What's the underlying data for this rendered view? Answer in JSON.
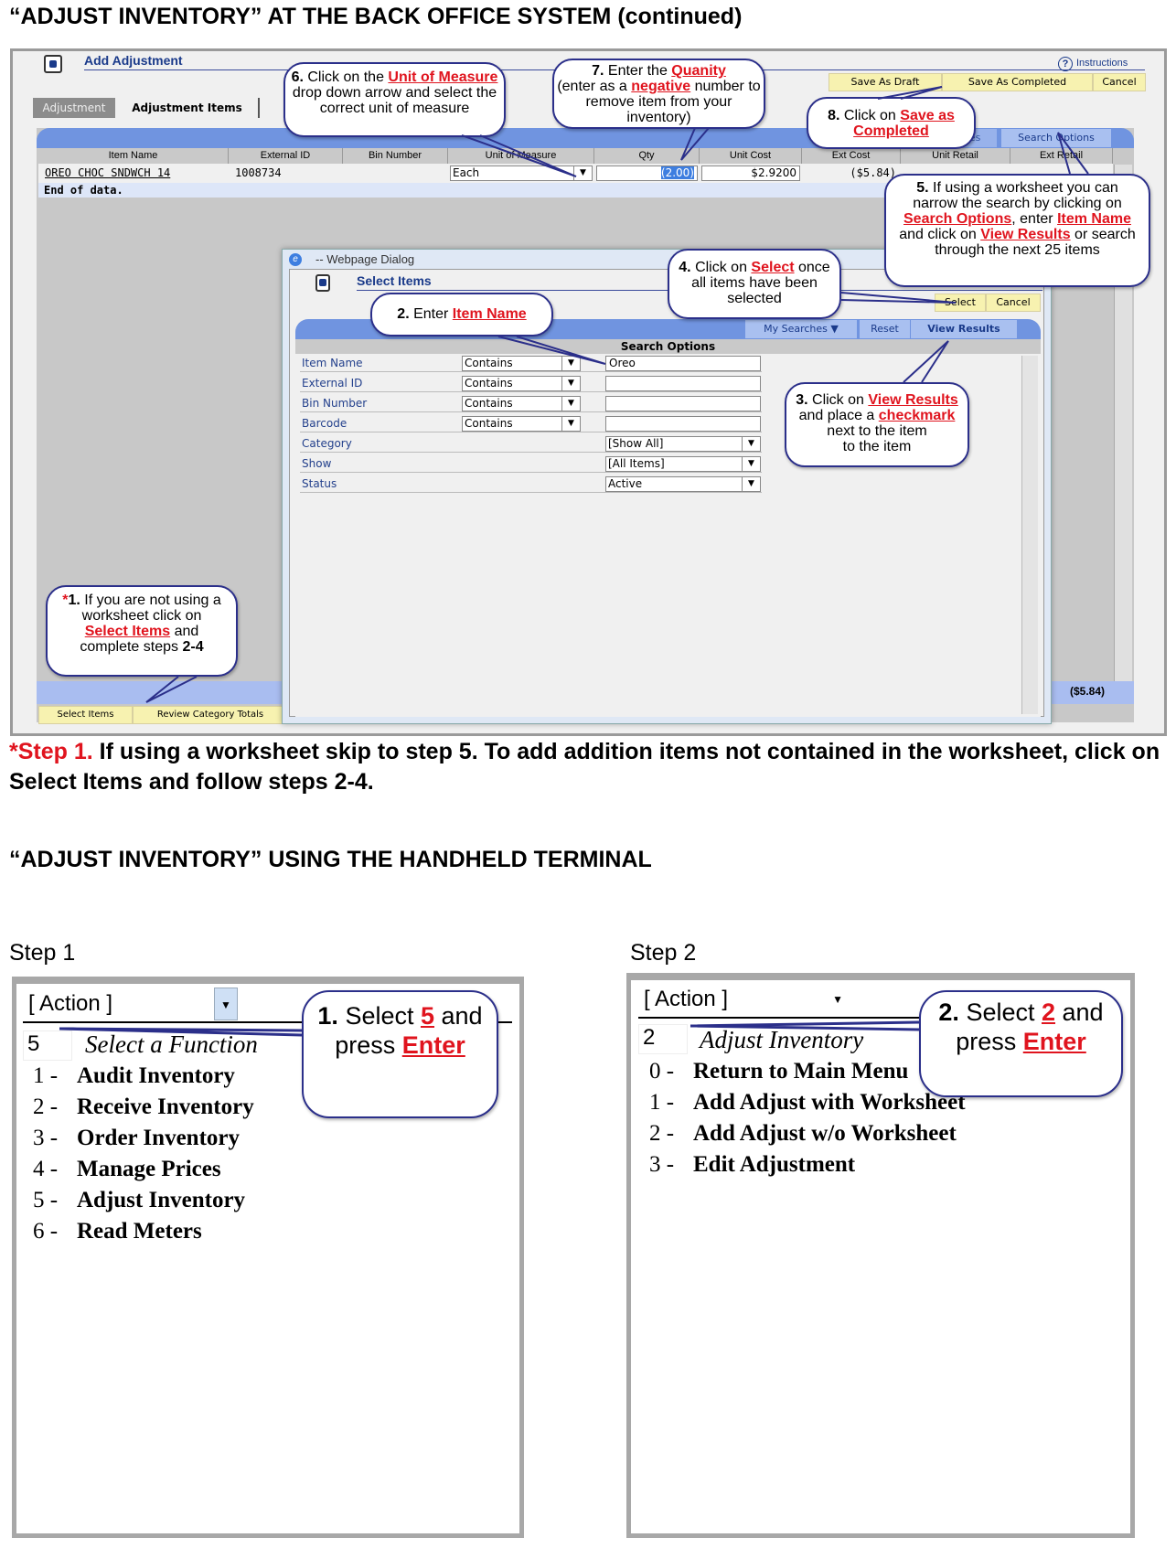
{
  "heading1": "“ADJUST INVENTORY” AT THE BACK OFFICE SYSTEM (continued)",
  "app": {
    "title": "Add Adjustment",
    "instructions": "Instructions",
    "buttons": {
      "save_draft": "Save As Draft",
      "save_completed": "Save As Completed",
      "cancel": "Cancel"
    },
    "tabs": [
      {
        "label": "Adjustment"
      },
      {
        "label": "Adjustment Items"
      }
    ],
    "search_options": "Search Options",
    "my_searches": "My Searches",
    "table": {
      "columns": [
        "Item Name",
        "External ID",
        "Bin Number",
        "Unit of Measure",
        "Qty",
        "Unit Cost",
        "Ext Cost",
        "Unit Retail",
        "Ext Retail"
      ],
      "row": {
        "item_name": "OREO CHOC SNDWCH 14",
        "external_id": "1008734",
        "bin": "",
        "uom": "Each",
        "qty": "(2.00)",
        "unit_cost": "$2.9200",
        "ext_cost": "($5.84)"
      },
      "end": "End of data.",
      "total": "($5.84)"
    },
    "bottom_buttons": {
      "select_items": "Select Items",
      "review": "Review Category Totals"
    }
  },
  "dialog": {
    "titlebar": "-- Webpage Dialog",
    "title": "Select Items",
    "select": "Select",
    "cancel": "Cancel",
    "my_searches": "My Searches",
    "reset": "Reset",
    "view_results": "View Results",
    "section": "Search Options",
    "rows": [
      {
        "label": "Item Name",
        "op": "Contains",
        "value": "Oreo"
      },
      {
        "label": "External ID",
        "op": "Contains",
        "value": ""
      },
      {
        "label": "Bin Number",
        "op": "Contains",
        "value": ""
      },
      {
        "label": "Barcode",
        "op": "Contains",
        "value": ""
      },
      {
        "label": "Category",
        "value": "[Show All]"
      },
      {
        "label": "Show",
        "value": "[All Items]"
      },
      {
        "label": "Status",
        "value": "Active"
      }
    ]
  },
  "callouts": {
    "c6": {
      "n": "6.",
      "a": " Click on the ",
      "r": "Unit of Measure",
      "b": " drop down arrow and select the correct unit of measure"
    },
    "c7": {
      "n": "7.",
      "a": " Enter the ",
      "r1": "Quanity",
      "b": "(enter as a ",
      "r2": "negative",
      "c": " number to remove item from your inventory)"
    },
    "c8": {
      "n": "8.",
      "a": " Click on ",
      "r": "Save as Completed"
    },
    "c5": {
      "n": "5.",
      "a": " If using a worksheet you can narrow the search by clicking on ",
      "r1": "Search Options",
      "b": ", enter ",
      "r2": "Item Name",
      "c": " and click on ",
      "r3": "View Results",
      "d": " or search through the next 25 items"
    },
    "c4": {
      "n": "4.",
      "a": " Click on ",
      "r": "Select",
      "b": " once all items have been selected"
    },
    "c2": {
      "n": "2.",
      "a": " Enter ",
      "r": "Item Name"
    },
    "c3": {
      "n": "3.",
      "a": " Click on ",
      "r1": "View Results",
      "b": " and place a ",
      "r2": "checkmark",
      "c": " next to the item"
    },
    "c1": {
      "star": "*",
      "n": "1.",
      "a": " If you are not using a worksheet click on ",
      "r": "Select Items",
      "b": " and complete steps ",
      "s": "2-4"
    }
  },
  "note": {
    "star": "*Step 1.",
    "text": " If using a worksheet skip to step 5. To add addition items not contained in the worksheet, click on Select Items and follow steps 2-4."
  },
  "heading2": "“ADJUST INVENTORY” USING THE HANDHELD TERMINAL",
  "step1": {
    "label": "Step 1",
    "action": "[ Action ]",
    "input": "5",
    "prompt": "Select a Function",
    "items": [
      {
        "n": "1",
        "t": "Audit Inventory"
      },
      {
        "n": "2",
        "t": "Receive Inventory"
      },
      {
        "n": "3",
        "t": "Order Inventory"
      },
      {
        "n": "4",
        "t": "Manage Prices"
      },
      {
        "n": "5",
        "t": "Adjust Inventory"
      },
      {
        "n": "6",
        "t": "Read Meters"
      }
    ],
    "callout": {
      "n": "1.",
      "a": " Select ",
      "r": "5",
      "b": " and press ",
      "r2": "Enter"
    }
  },
  "step2": {
    "label": "Step 2",
    "action": "[ Action ]",
    "input": "2",
    "prompt": "Adjust Inventory",
    "items": [
      {
        "n": "0",
        "t": "Return to Main Menu"
      },
      {
        "n": "1",
        "t": "Add Adjust with Worksheet"
      },
      {
        "n": "2",
        "t": "Add Adjust w/o Worksheet"
      },
      {
        "n": "3",
        "t": "Edit Adjustment"
      }
    ],
    "callout": {
      "n": "2.",
      "a": " Select ",
      "r": "2",
      "b": " and press ",
      "r2": "Enter"
    }
  },
  "colors": {
    "accent_blue": "#7094e0",
    "button_yellow": "#f7f2b0",
    "callout_border": "#2b2f8a",
    "highlight_red": "#e0141e"
  }
}
